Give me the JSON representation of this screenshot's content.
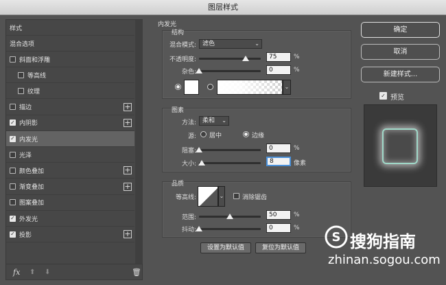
{
  "window": {
    "title": "图层样式"
  },
  "left_panel": {
    "header": "样式",
    "blend_options": "混合选项",
    "items": [
      {
        "label": "斜面和浮雕",
        "checked": false,
        "indent": 0,
        "plus": false
      },
      {
        "label": "等高线",
        "checked": false,
        "indent": 1,
        "plus": false
      },
      {
        "label": "纹理",
        "checked": false,
        "indent": 1,
        "plus": false
      },
      {
        "label": "描边",
        "checked": false,
        "indent": 0,
        "plus": true
      },
      {
        "label": "内阴影",
        "checked": true,
        "indent": 0,
        "plus": true
      },
      {
        "label": "内发光",
        "checked": true,
        "indent": 0,
        "plus": false,
        "selected": true
      },
      {
        "label": "光泽",
        "checked": false,
        "indent": 0,
        "plus": false
      },
      {
        "label": "颜色叠加",
        "checked": false,
        "indent": 0,
        "plus": true
      },
      {
        "label": "渐变叠加",
        "checked": false,
        "indent": 0,
        "plus": true
      },
      {
        "label": "图案叠加",
        "checked": false,
        "indent": 0,
        "plus": false
      },
      {
        "label": "外发光",
        "checked": true,
        "indent": 0,
        "plus": false
      },
      {
        "label": "投影",
        "checked": true,
        "indent": 0,
        "plus": true
      }
    ],
    "footer": {
      "fx": "fx"
    }
  },
  "inner_glow": {
    "title": "内发光",
    "structure": {
      "title": "结构",
      "blend_mode_label": "混合模式:",
      "blend_mode_value": "滤色",
      "opacity_label": "不透明度:",
      "opacity_value": "75",
      "opacity_percent": 75,
      "noise_label": "杂色:",
      "noise_value": "0",
      "noise_percent": 0,
      "unit": "%"
    },
    "elements": {
      "title": "图素",
      "method_label": "方法:",
      "method_value": "柔和",
      "source_label": "源:",
      "source_center": "居中",
      "source_edge": "边缘",
      "source_selected": "edge",
      "choke_label": "阻塞:",
      "choke_value": "0",
      "choke_percent": 0,
      "size_label": "大小:",
      "size_value": "8",
      "size_unit": "像素",
      "size_percent": 4,
      "unit": "%"
    },
    "quality": {
      "title": "品质",
      "contour_label": "等高线:",
      "anti_alias_label": "消除锯齿",
      "range_label": "范围:",
      "range_value": "50",
      "range_percent": 50,
      "jitter_label": "抖动:",
      "jitter_value": "0",
      "jitter_percent": 0,
      "unit": "%"
    },
    "buttons": {
      "set_default": "设置为默认值",
      "reset_default": "复位为默认值"
    }
  },
  "right_panel": {
    "ok": "确定",
    "cancel": "取消",
    "new_style": "新建样式...",
    "preview_label": "预览",
    "preview_checked": true
  },
  "watermark": {
    "brand": "搜狗指南",
    "url": "zhinan.sogou.com"
  },
  "colors": {
    "selected_row": "#636363",
    "focus": "#4a90d9",
    "glow": "#9fd8c8"
  }
}
